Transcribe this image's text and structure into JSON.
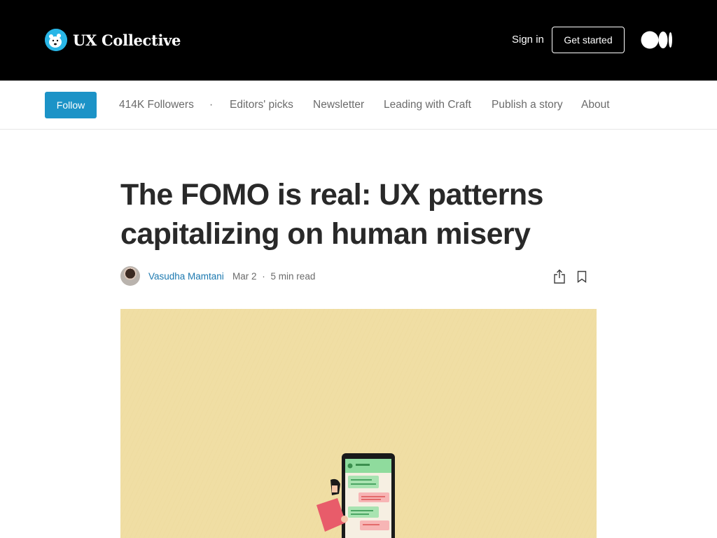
{
  "header": {
    "brand_name": "UX Collective",
    "sign_in": "Sign in",
    "get_started": "Get started"
  },
  "pubnav": {
    "follow": "Follow",
    "followers": "414K Followers",
    "separator": "·",
    "items": [
      "Editors' picks",
      "Newsletter",
      "Leading with Craft",
      "Publish a story",
      "About"
    ]
  },
  "article": {
    "title_line1": "The FOMO is real: UX patterns",
    "title_line2": "capitalizing on human misery",
    "author": "Vasudha Mamtani",
    "date": "Mar 2",
    "dot": "·",
    "read_time": "5 min read"
  },
  "colors": {
    "header_bg": "#000000",
    "follow_bg": "#1c93c7",
    "author_link": "#1c79b0",
    "hero_bg": "#f0dea4"
  },
  "icons": {
    "brand_logo": "polar-bear-logo",
    "medium": "medium-logo-icon",
    "share": "share-icon",
    "bookmark": "bookmark-icon"
  }
}
